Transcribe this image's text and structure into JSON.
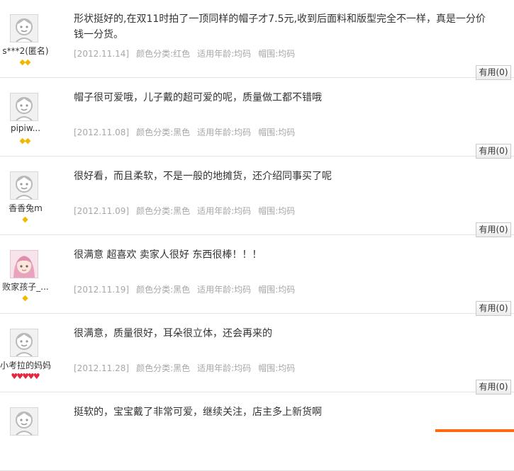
{
  "reviews": [
    {
      "username": "s***2(匿名)",
      "avatar": "default-avatar",
      "level": "◆◆",
      "level_type": "gold",
      "content": "形状挺好的,在双11时拍了一顶同样的帽子才7.5元,收到后面料和版型完全不一样，真是一分价钱一分货。",
      "date": "[2012.11.14]",
      "color": "颜色分类:红色",
      "age": "适用年龄:均码",
      "size": "帽围:均码",
      "useful_label": "有用",
      "useful_count": "(0)"
    },
    {
      "username": "pipiw...",
      "avatar": "default-avatar",
      "level": "◆◆",
      "level_type": "gold",
      "content": "帽子很可爱哦，儿子戴的超可爱的呢，质量做工都不错哦",
      "date": "[2012.11.08]",
      "color": "颜色分类:黑色",
      "age": "适用年龄:均码",
      "size": "帽围:均码",
      "useful_label": "有用",
      "useful_count": "(0)"
    },
    {
      "username": "香香兔m",
      "avatar": "default-avatar",
      "level": "◆",
      "level_type": "gold",
      "content": "很好看，而且柔软，不是一般的地摊货，还介绍同事买了呢",
      "date": "[2012.11.09]",
      "color": "颜色分类:黑色",
      "age": "适用年龄:均码",
      "size": "帽围:均码",
      "useful_label": "有用",
      "useful_count": "(0)"
    },
    {
      "username": "败家孩子_...",
      "avatar": "photo-avatar",
      "level": "◆",
      "level_type": "gold",
      "content": "很满意 超喜欢 卖家人很好 东西很棒！！！",
      "date": "[2012.11.19]",
      "color": "颜色分类:黑色",
      "age": "适用年龄:均码",
      "size": "帽围:均码",
      "useful_label": "有用",
      "useful_count": "(0)"
    },
    {
      "username": "小考拉的妈妈",
      "avatar": "default-avatar",
      "level": "♥♥♥♥♥",
      "level_type": "red",
      "content": "很满意，质量很好，耳朵很立体，还会再来的",
      "date": "[2012.11.28]",
      "color": "颜色分类:黑色",
      "age": "适用年龄:均码",
      "size": "帽围:均码",
      "useful_label": "有用",
      "useful_count": "(0)"
    },
    {
      "username": "",
      "avatar": "default-avatar",
      "level": "",
      "level_type": "gold",
      "content": "挺软的，宝宝戴了非常可爱，继续关注，店主多上新货啊",
      "date": "",
      "color": "",
      "age": "",
      "size": "",
      "useful_label": "",
      "useful_count": ""
    }
  ],
  "colors": {
    "meta_text": "#a7a7a7",
    "divider": "#e3e3e3",
    "accent_orange": "#ff6a13"
  }
}
